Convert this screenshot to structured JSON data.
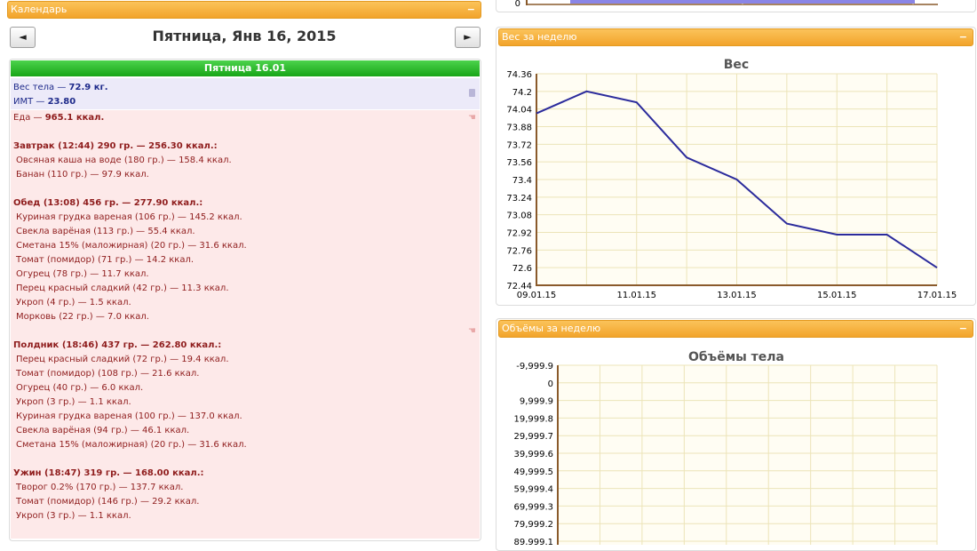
{
  "calendar": {
    "header": "Календарь",
    "minimize": "−",
    "prev": "◄",
    "next": "►",
    "date_title": "Пятница, Янв 16, 2015",
    "day_label": "Пятница 16.01",
    "weight_prefix": "Вес тела — ",
    "weight_value": "72.9 кг.",
    "bmi_prefix": "ИМТ — ",
    "bmi_value": "23.80",
    "food_prefix": "Еда — ",
    "food_total": "965.1 ккал.",
    "meals": [
      {
        "title": "Завтрак (12:44) 290 гр. — 256.30 ккал.:",
        "items": [
          "Овсяная каша на воде (180 гр.) — 158.4 ккал.",
          "Банан (110 гр.) — 97.9 ккал."
        ]
      },
      {
        "title": "Обед (13:08) 456 гр. — 277.90 ккал.:",
        "items": [
          "Куриная грудка вареная (106 гр.) — 145.2 ккал.",
          "Свекла варёная (113 гр.) — 55.4 ккал.",
          "Сметана 15% (маложирная) (20 гр.) — 31.6 ккал.",
          "Томат (помидор) (71 гр.) — 14.2 ккал.",
          "Огурец (78 гр.) — 11.7 ккал.",
          "Перец красный сладкий (42 гр.) — 11.3 ккал.",
          "Укроп (4 гр.) — 1.5 ккал.",
          "Морковь (22 гр.) — 7.0 ккал."
        ]
      },
      {
        "title": "Полдник (18:46) 437 гр. — 262.80 ккал.:",
        "items": [
          "Перец красный сладкий (72 гр.) — 19.4 ккал.",
          "Томат (помидор) (108 гр.) — 21.6 ккал.",
          "Огурец (40 гр.) — 6.0 ккал.",
          "Укроп (3 гр.) — 1.1 ккал.",
          "Куриная грудка вареная (100 гр.) — 137.0 ккал.",
          "Свекла варёная (94 гр.) — 46.1 ккал.",
          "Сметана 15% (маложирная) (20 гр.) — 31.6 ккал."
        ]
      },
      {
        "title": "Ужин (18:47) 319 гр. — 168.00 ккал.:",
        "items": [
          "Творог 0.2% (170 гр.) — 137.7 ккал.",
          "Томат (помидор) (146 гр.) — 29.2 ккал.",
          "Укроп (3 гр.) — 1.1 ккал."
        ]
      }
    ]
  },
  "top_partial": {
    "tick_label": "0",
    "bar_color": "#8a85e6"
  },
  "weight_panel": {
    "header": "Вес за неделю",
    "minimize": "−"
  },
  "volume_panel": {
    "header": "Объёмы за неделю",
    "minimize": "−"
  },
  "chart_data": [
    {
      "type": "line",
      "title": "Вес",
      "xlabel": "",
      "ylabel": "",
      "x": [
        "09.01.15",
        "10.01.15",
        "11.01.15",
        "12.01.15",
        "13.01.15",
        "14.01.15",
        "15.01.15",
        "16.01.15",
        "17.01.15"
      ],
      "x_tick_labels": [
        "09.01.15",
        "11.01.15",
        "13.01.15",
        "15.01.15",
        "17.01.15"
      ],
      "y_tick_labels": [
        "74.36",
        "74.2",
        "74.04",
        "73.88",
        "73.72",
        "73.56",
        "73.4",
        "73.24",
        "73.08",
        "72.92",
        "72.76",
        "72.6",
        "72.44"
      ],
      "ylim": [
        72.44,
        74.36
      ],
      "series": [
        {
          "values": [
            74.0,
            74.2,
            74.1,
            73.6,
            73.4,
            73.0,
            72.9,
            72.9,
            72.6
          ]
        }
      ],
      "line_color": "#2b2b9c",
      "grid": true
    },
    {
      "type": "line",
      "title": "Объёмы тела",
      "y_tick_labels": [
        "-9,999.9",
        "0",
        "9,999.9",
        "19,999.8",
        "29,999.7",
        "39,999.6",
        "49,999.5",
        "59,999.4",
        "69,999.3",
        "79,999.2",
        "89,999.1"
      ],
      "series": [],
      "grid": true
    }
  ]
}
